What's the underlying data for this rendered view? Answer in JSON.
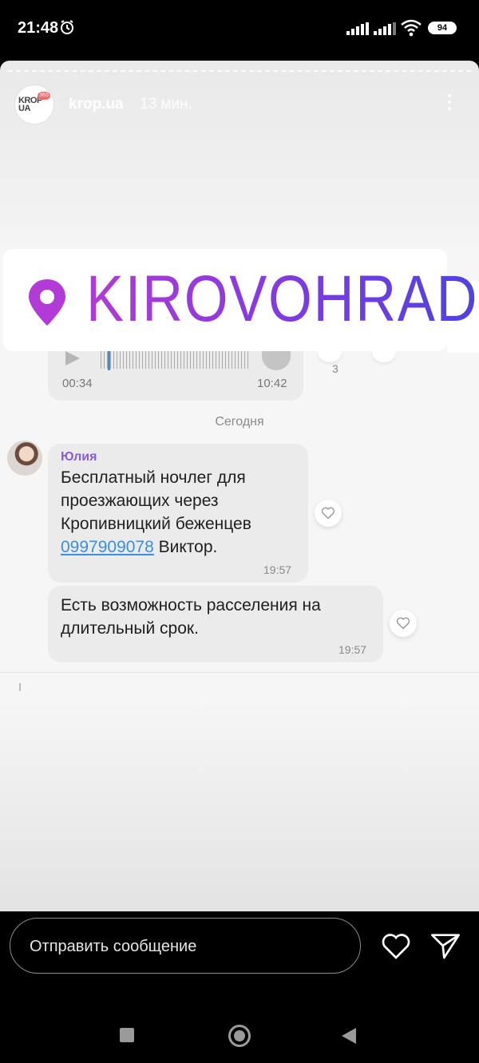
{
  "status_bar": {
    "time": "21:48",
    "battery": "94",
    "icons": [
      "alarm-icon",
      "cell-signal-icon",
      "cell-signal-icon",
      "wifi-icon",
      "battery-icon"
    ]
  },
  "story": {
    "account": {
      "name": "krop.ua",
      "posted": "13 мин.",
      "logo_text_line1": "KROP",
      "logo_text_line2": "UA",
      "logo_badge": "365"
    },
    "sticker": {
      "location": "KIROVOHRAD",
      "pin_color": "#b23ad6"
    },
    "chat": {
      "audio": {
        "position": "00:34",
        "duration": "10:42",
        "reaction_count": "3",
        "progress": 0.05
      },
      "date_separator": "Сегодня",
      "messages": [
        {
          "sender": "Юлия",
          "text_before_phone": "Бесплатный ночлег для проезжающих через Кропивницкий беженцев",
          "phone": "0997909078",
          "text_after_phone": " Виктор.",
          "time": "19:57"
        },
        {
          "text": "Есть возможность расселения на длительный срок.",
          "time": "19:57"
        }
      ]
    }
  },
  "reply_bar": {
    "placeholder": "Отправить сообщение",
    "icons": [
      "heart-icon",
      "send-icon"
    ]
  },
  "nav_bar": {
    "icons": [
      "recent-apps-icon",
      "home-icon",
      "back-icon"
    ]
  }
}
